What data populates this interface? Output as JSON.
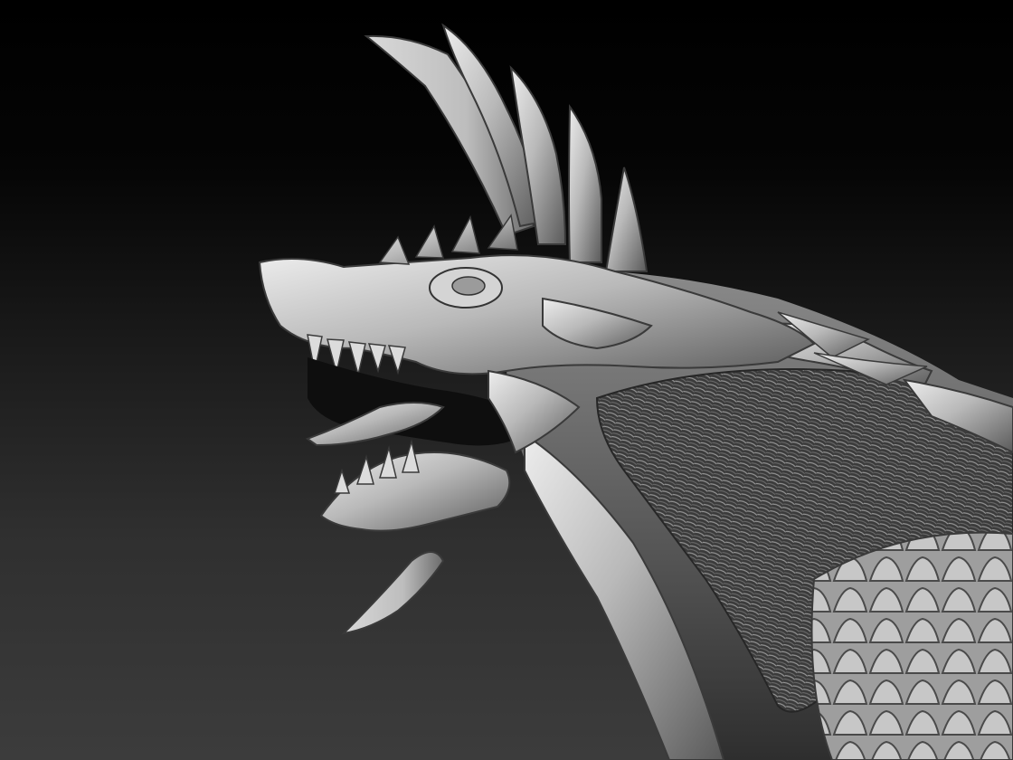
{
  "scene": {
    "subject_icon": "dragon-sculpt-render",
    "background_top_color": "#000000",
    "background_bottom_color": "#3c3c3c",
    "material_color": "#b9b9b9",
    "material_shadow_color": "#3a3a3a",
    "material_highlight_color": "#ededed"
  }
}
